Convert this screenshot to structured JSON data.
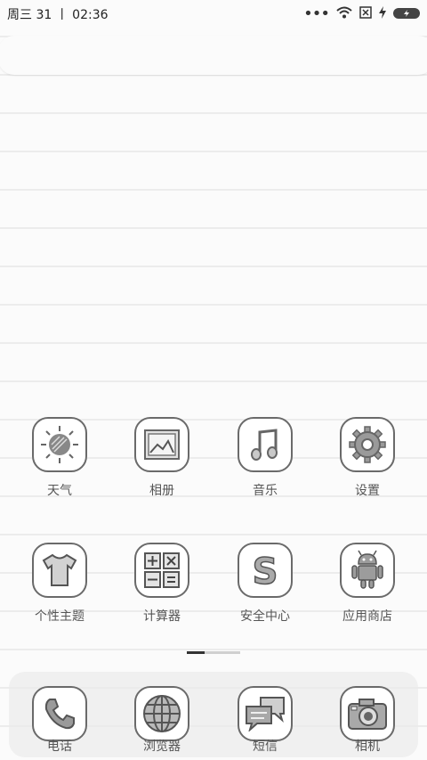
{
  "status_bar": {
    "datetime": "周三  31 丨 02:36"
  },
  "apps_row1": [
    {
      "label": "天气",
      "icon": "weather-sun-icon"
    },
    {
      "label": "相册",
      "icon": "gallery-photo-icon"
    },
    {
      "label": "音乐",
      "icon": "music-note-icon"
    },
    {
      "label": "设置",
      "icon": "settings-gear-icon"
    }
  ],
  "apps_row2": [
    {
      "label": "个性主题",
      "icon": "theme-shirt-icon"
    },
    {
      "label": "计算器",
      "icon": "calculator-icon"
    },
    {
      "label": "安全中心",
      "icon": "security-s-icon"
    },
    {
      "label": "应用商店",
      "icon": "android-robot-icon"
    }
  ],
  "dock": [
    {
      "label": "电话",
      "icon": "phone-handset-icon"
    },
    {
      "label": "浏览器",
      "icon": "browser-globe-icon"
    },
    {
      "label": "短信",
      "icon": "messages-bubbles-icon"
    },
    {
      "label": "相机",
      "icon": "camera-icon"
    }
  ]
}
